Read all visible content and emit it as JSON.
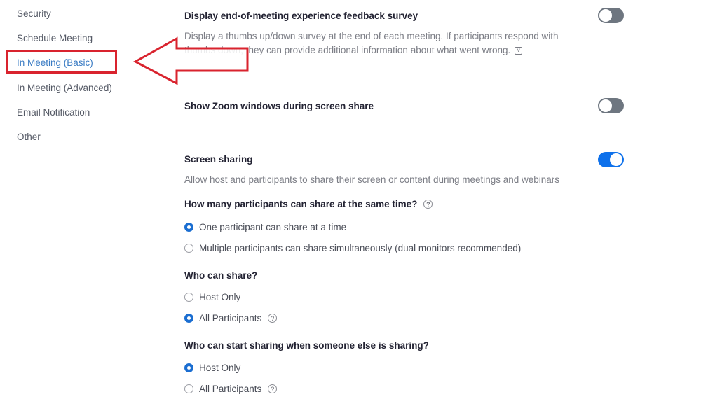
{
  "sidebar": {
    "items": [
      {
        "label": "Security"
      },
      {
        "label": "Schedule Meeting"
      },
      {
        "label": "In Meeting (Basic)",
        "active": true
      },
      {
        "label": "In Meeting (Advanced)"
      },
      {
        "label": "Email Notification"
      },
      {
        "label": "Other"
      }
    ]
  },
  "annotation": {
    "highlight_color": "#d9232e",
    "arrow_target": "In Meeting (Basic)"
  },
  "settings": {
    "feedback_survey": {
      "title": "Display end-of-meeting experience feedback survey",
      "description": "Display a thumbs up/down survey at the end of each meeting. If participants respond with thumbs down, they can provide additional information about what went wrong.",
      "version_icon": "v-icon",
      "enabled": false
    },
    "show_zoom_windows": {
      "title": "Show Zoom windows during screen share",
      "enabled": false
    },
    "screen_sharing": {
      "title": "Screen sharing",
      "description": "Allow host and participants to share their screen or content during meetings and webinars",
      "enabled": true,
      "how_many": {
        "question": "How many participants can share at the same time?",
        "help_icon": "?",
        "options": [
          {
            "label": "One participant can share at a time",
            "checked": true
          },
          {
            "label": "Multiple participants can share simultaneously (dual monitors recommended)",
            "checked": false
          }
        ]
      },
      "who_can_share": {
        "question": "Who can share?",
        "options": [
          {
            "label": "Host Only",
            "checked": false
          },
          {
            "label": "All Participants",
            "checked": true,
            "help_icon": "?"
          }
        ]
      },
      "who_can_start": {
        "question": "Who can start sharing when someone else is sharing?",
        "options": [
          {
            "label": "Host Only",
            "checked": true
          },
          {
            "label": "All Participants",
            "checked": false,
            "help_icon": "?"
          }
        ]
      }
    }
  },
  "colors": {
    "accent": "#0e71eb",
    "toggle_off": "#6e7680",
    "active_nav": "#3b7cc4"
  }
}
